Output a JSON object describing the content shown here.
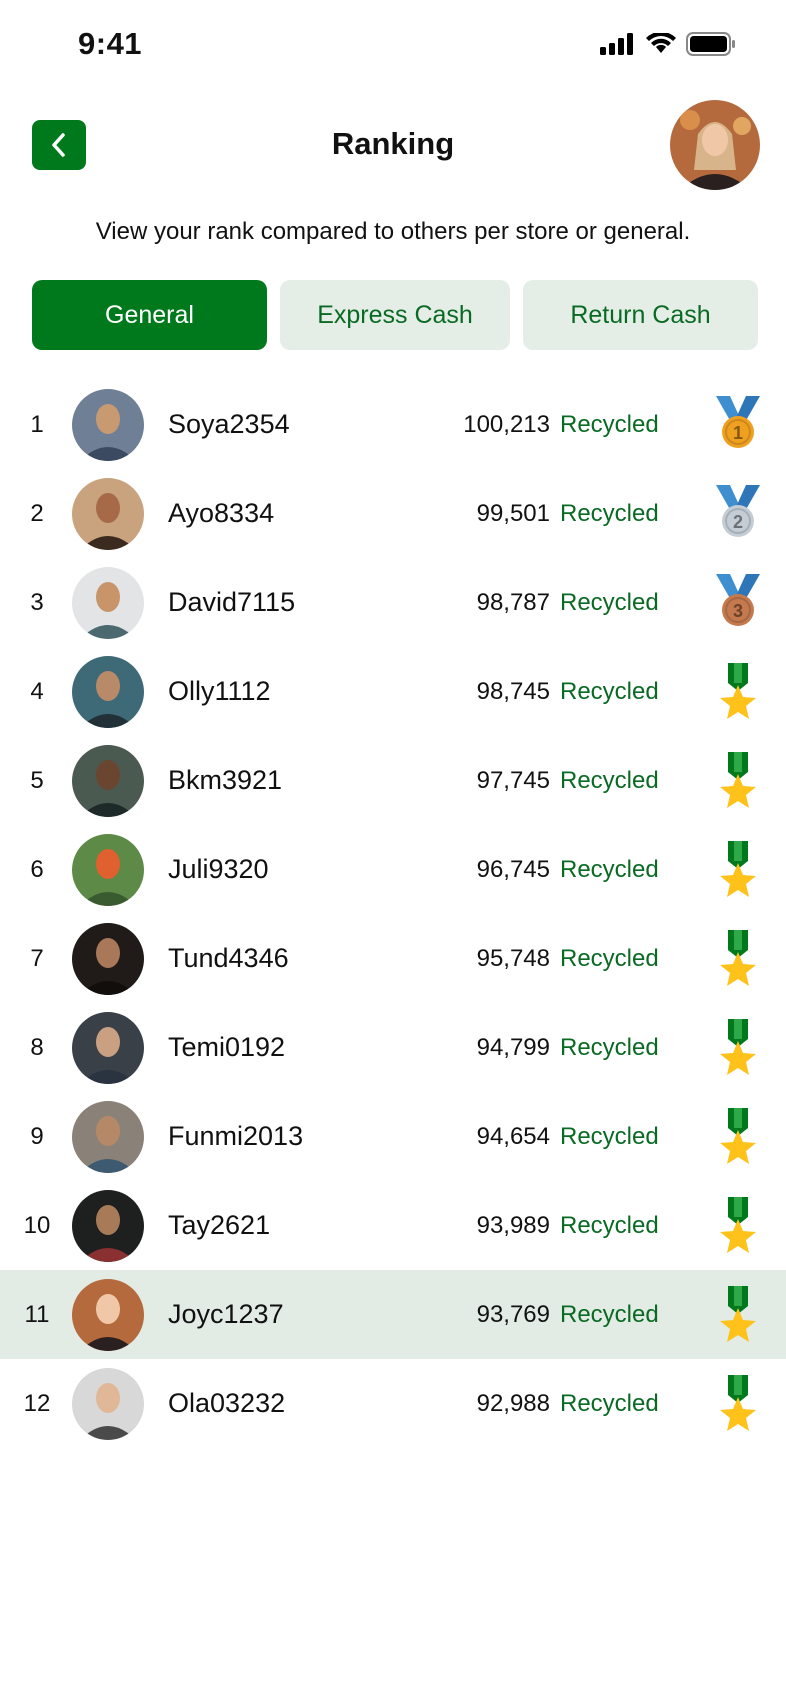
{
  "status": {
    "time": "9:41"
  },
  "header": {
    "title": "Ranking"
  },
  "subtitle": "View your rank compared to others per store or general.",
  "tabs": [
    {
      "label": "General",
      "active": true
    },
    {
      "label": "Express Cash",
      "active": false
    },
    {
      "label": "Return Cash",
      "active": false
    }
  ],
  "ranking": [
    {
      "rank": "1",
      "username": "Soya2354",
      "score": "100,213",
      "label": "Recycled",
      "medal": "gold-medal-icon"
    },
    {
      "rank": "2",
      "username": "Ayo8334",
      "score": "99,501",
      "label": "Recycled",
      "medal": "silver-medal-icon"
    },
    {
      "rank": "3",
      "username": "David7115",
      "score": "98,787",
      "label": "Recycled",
      "medal": "bronze-medal-icon"
    },
    {
      "rank": "4",
      "username": "Olly1112",
      "score": "98,745",
      "label": "Recycled",
      "medal": "star-medal-icon"
    },
    {
      "rank": "5",
      "username": "Bkm3921",
      "score": "97,745",
      "label": "Recycled",
      "medal": "star-medal-icon"
    },
    {
      "rank": "6",
      "username": "Juli9320",
      "score": "96,745",
      "label": "Recycled",
      "medal": "star-medal-icon"
    },
    {
      "rank": "7",
      "username": "Tund4346",
      "score": "95,748",
      "label": "Recycled",
      "medal": "star-medal-icon"
    },
    {
      "rank": "8",
      "username": "Temi0192",
      "score": "94,799",
      "label": "Recycled",
      "medal": "star-medal-icon"
    },
    {
      "rank": "9",
      "username": "Funmi2013",
      "score": "94,654",
      "label": "Recycled",
      "medal": "star-medal-icon"
    },
    {
      "rank": "10",
      "username": "Tay2621",
      "score": "93,989",
      "label": "Recycled",
      "medal": "star-medal-icon"
    },
    {
      "rank": "11",
      "username": "Joyc1237",
      "score": "93,769",
      "label": "Recycled",
      "medal": "star-medal-icon",
      "current_user": true
    },
    {
      "rank": "12",
      "username": "Ola03232",
      "score": "92,988",
      "label": "Recycled",
      "medal": "star-medal-icon"
    }
  ],
  "colors": {
    "primary": "#00791d",
    "tab_inactive_bg": "#e4eee7",
    "highlight_bg": "#e2ece4",
    "gold": "#f0a020",
    "silver": "#c4cdd6",
    "bronze": "#c47a4e",
    "star": "#ffc21a",
    "ribbon_blue": "#3f8fd0"
  }
}
